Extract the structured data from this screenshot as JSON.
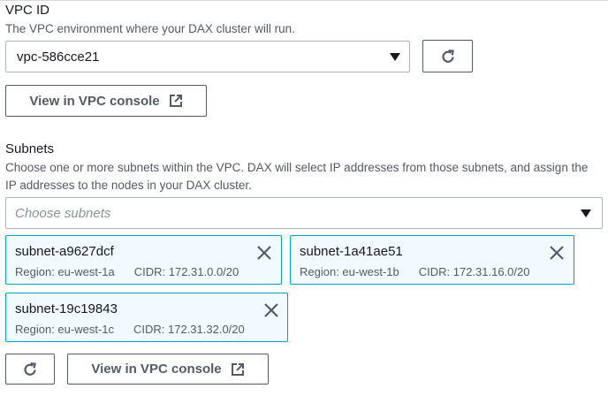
{
  "vpc": {
    "label": "VPC ID",
    "description": "The VPC environment where your DAX cluster will run.",
    "selected": "vpc-586cce21",
    "view_console_label": "View in VPC console"
  },
  "subnets": {
    "label": "Subnets",
    "description_line1": "Choose one or more subnets within the VPC. DAX will select IP addresses from those subnets, and assign the",
    "description_line2": "IP addresses to the nodes in your DAX cluster.",
    "placeholder": "Choose subnets",
    "tokens": [
      {
        "name": "subnet-a9627dcf",
        "region": "Region: eu-west-1a",
        "cidr": "CIDR: 172.31.0.0/20"
      },
      {
        "name": "subnet-1a41ae51",
        "region": "Region: eu-west-1b",
        "cidr": "CIDR: 172.31.16.0/20"
      },
      {
        "name": "subnet-19c19843",
        "region": "Region: eu-west-1c",
        "cidr": "CIDR: 172.31.32.0/20"
      }
    ],
    "view_console_label": "View in VPC console"
  }
}
